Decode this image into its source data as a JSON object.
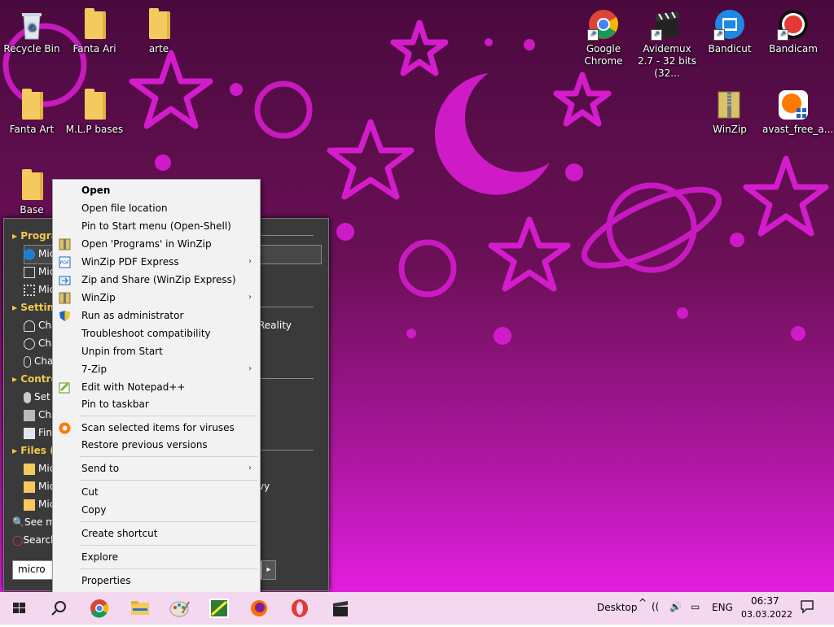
{
  "desktop": {
    "icons": [
      {
        "label": "Recycle Bin"
      },
      {
        "label": "Fanta Ari"
      },
      {
        "label": "arte"
      },
      {
        "label": "Fanta Art"
      },
      {
        "label": "M.L.P bases"
      },
      {
        "label": "Base"
      },
      {
        "label": "Google Chrome"
      },
      {
        "label": "Avidemux 2.7 - 32 bits (32..."
      },
      {
        "label": "Bandicut"
      },
      {
        "label": "Bandicam"
      },
      {
        "label": "WinZip"
      },
      {
        "label": "avast_free_a..."
      }
    ],
    "colors": {
      "background_top": "#4a0a3e",
      "background_bottom": "#e21ee0",
      "stars": "#d61ad0"
    }
  },
  "start_menu": {
    "rows": [
      {
        "text": "Progra",
        "heading": true
      },
      {
        "text": "Mic"
      },
      {
        "text": "Mic"
      },
      {
        "text": "Mic"
      },
      {
        "text": "Settin",
        "heading": true
      },
      {
        "text": "Cha"
      },
      {
        "text": "Cha"
      },
      {
        "text": "Cha"
      },
      {
        "text": "Contro",
        "heading": true
      },
      {
        "text": "Set"
      },
      {
        "text": "Cha"
      },
      {
        "text": "Fin"
      },
      {
        "text": "Files (",
        "heading": true
      },
      {
        "text": "Mic"
      },
      {
        "text": "Mic"
      },
      {
        "text": "Mic"
      },
      {
        "text": "See m"
      },
      {
        "text": "Search"
      }
    ],
    "right_fragments": [
      "Reality",
      "vy"
    ],
    "search_value": "micro"
  },
  "context_menu": {
    "items": [
      {
        "label": "Open",
        "bold": true
      },
      {
        "label": "Open file location"
      },
      {
        "label": "Pin to Start menu (Open-Shell)"
      },
      {
        "label": "Open 'Programs' in WinZip",
        "icon": "winzip-icon"
      },
      {
        "label": "WinZip PDF Express",
        "icon": "pdf-icon",
        "submenu": true
      },
      {
        "label": "Zip and Share (WinZip Express)",
        "icon": "zip-share-icon"
      },
      {
        "label": "WinZip",
        "icon": "winzip-icon",
        "submenu": true
      },
      {
        "label": "Run as administrator",
        "icon": "uac-shield-icon"
      },
      {
        "label": "Troubleshoot compatibility"
      },
      {
        "label": "Unpin from Start"
      },
      {
        "label": "7-Zip",
        "submenu": true
      },
      {
        "label": "Edit with Notepad++",
        "icon": "notepadpp-icon"
      },
      {
        "label": "Pin to taskbar"
      },
      {
        "label": "Scan selected items for viruses",
        "icon": "avast-icon"
      },
      {
        "label": "Restore previous versions"
      },
      {
        "label": "Send to",
        "submenu": true
      },
      {
        "label": "Cut"
      },
      {
        "label": "Copy"
      },
      {
        "label": "Create shortcut"
      },
      {
        "label": "Explore"
      },
      {
        "label": "Properties"
      }
    ],
    "submenu_arrow": "›"
  },
  "taskbar": {
    "apps": [
      "start-icon",
      "search-icon",
      "chrome-icon",
      "file-explorer-icon",
      "paint-icon",
      "ms-paint-app-icon",
      "firefox-icon",
      "opera-icon",
      "avidemux-icon"
    ],
    "desktop_label": "Desktop",
    "chevron": "^",
    "language": "ENG",
    "time": "06:37",
    "date": "03.03.2022",
    "color": "#f3d8f0"
  }
}
